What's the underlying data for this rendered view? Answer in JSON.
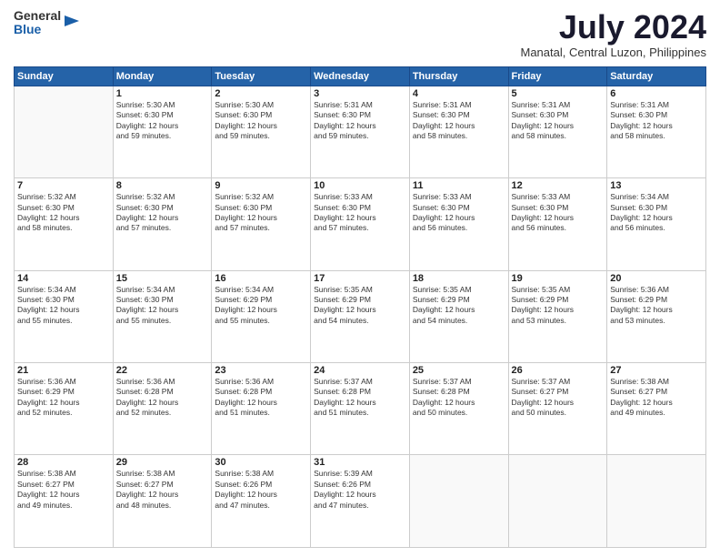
{
  "logo": {
    "general": "General",
    "blue": "Blue"
  },
  "title": "July 2024",
  "location": "Manatal, Central Luzon, Philippines",
  "days_of_week": [
    "Sunday",
    "Monday",
    "Tuesday",
    "Wednesday",
    "Thursday",
    "Friday",
    "Saturday"
  ],
  "weeks": [
    [
      {
        "day": "",
        "info": ""
      },
      {
        "day": "1",
        "info": "Sunrise: 5:30 AM\nSunset: 6:30 PM\nDaylight: 12 hours\nand 59 minutes."
      },
      {
        "day": "2",
        "info": "Sunrise: 5:30 AM\nSunset: 6:30 PM\nDaylight: 12 hours\nand 59 minutes."
      },
      {
        "day": "3",
        "info": "Sunrise: 5:31 AM\nSunset: 6:30 PM\nDaylight: 12 hours\nand 59 minutes."
      },
      {
        "day": "4",
        "info": "Sunrise: 5:31 AM\nSunset: 6:30 PM\nDaylight: 12 hours\nand 58 minutes."
      },
      {
        "day": "5",
        "info": "Sunrise: 5:31 AM\nSunset: 6:30 PM\nDaylight: 12 hours\nand 58 minutes."
      },
      {
        "day": "6",
        "info": "Sunrise: 5:31 AM\nSunset: 6:30 PM\nDaylight: 12 hours\nand 58 minutes."
      }
    ],
    [
      {
        "day": "7",
        "info": "Sunrise: 5:32 AM\nSunset: 6:30 PM\nDaylight: 12 hours\nand 58 minutes."
      },
      {
        "day": "8",
        "info": "Sunrise: 5:32 AM\nSunset: 6:30 PM\nDaylight: 12 hours\nand 57 minutes."
      },
      {
        "day": "9",
        "info": "Sunrise: 5:32 AM\nSunset: 6:30 PM\nDaylight: 12 hours\nand 57 minutes."
      },
      {
        "day": "10",
        "info": "Sunrise: 5:33 AM\nSunset: 6:30 PM\nDaylight: 12 hours\nand 57 minutes."
      },
      {
        "day": "11",
        "info": "Sunrise: 5:33 AM\nSunset: 6:30 PM\nDaylight: 12 hours\nand 56 minutes."
      },
      {
        "day": "12",
        "info": "Sunrise: 5:33 AM\nSunset: 6:30 PM\nDaylight: 12 hours\nand 56 minutes."
      },
      {
        "day": "13",
        "info": "Sunrise: 5:34 AM\nSunset: 6:30 PM\nDaylight: 12 hours\nand 56 minutes."
      }
    ],
    [
      {
        "day": "14",
        "info": "Sunrise: 5:34 AM\nSunset: 6:30 PM\nDaylight: 12 hours\nand 55 minutes."
      },
      {
        "day": "15",
        "info": "Sunrise: 5:34 AM\nSunset: 6:30 PM\nDaylight: 12 hours\nand 55 minutes."
      },
      {
        "day": "16",
        "info": "Sunrise: 5:34 AM\nSunset: 6:29 PM\nDaylight: 12 hours\nand 55 minutes."
      },
      {
        "day": "17",
        "info": "Sunrise: 5:35 AM\nSunset: 6:29 PM\nDaylight: 12 hours\nand 54 minutes."
      },
      {
        "day": "18",
        "info": "Sunrise: 5:35 AM\nSunset: 6:29 PM\nDaylight: 12 hours\nand 54 minutes."
      },
      {
        "day": "19",
        "info": "Sunrise: 5:35 AM\nSunset: 6:29 PM\nDaylight: 12 hours\nand 53 minutes."
      },
      {
        "day": "20",
        "info": "Sunrise: 5:36 AM\nSunset: 6:29 PM\nDaylight: 12 hours\nand 53 minutes."
      }
    ],
    [
      {
        "day": "21",
        "info": "Sunrise: 5:36 AM\nSunset: 6:29 PM\nDaylight: 12 hours\nand 52 minutes."
      },
      {
        "day": "22",
        "info": "Sunrise: 5:36 AM\nSunset: 6:28 PM\nDaylight: 12 hours\nand 52 minutes."
      },
      {
        "day": "23",
        "info": "Sunrise: 5:36 AM\nSunset: 6:28 PM\nDaylight: 12 hours\nand 51 minutes."
      },
      {
        "day": "24",
        "info": "Sunrise: 5:37 AM\nSunset: 6:28 PM\nDaylight: 12 hours\nand 51 minutes."
      },
      {
        "day": "25",
        "info": "Sunrise: 5:37 AM\nSunset: 6:28 PM\nDaylight: 12 hours\nand 50 minutes."
      },
      {
        "day": "26",
        "info": "Sunrise: 5:37 AM\nSunset: 6:27 PM\nDaylight: 12 hours\nand 50 minutes."
      },
      {
        "day": "27",
        "info": "Sunrise: 5:38 AM\nSunset: 6:27 PM\nDaylight: 12 hours\nand 49 minutes."
      }
    ],
    [
      {
        "day": "28",
        "info": "Sunrise: 5:38 AM\nSunset: 6:27 PM\nDaylight: 12 hours\nand 49 minutes."
      },
      {
        "day": "29",
        "info": "Sunrise: 5:38 AM\nSunset: 6:27 PM\nDaylight: 12 hours\nand 48 minutes."
      },
      {
        "day": "30",
        "info": "Sunrise: 5:38 AM\nSunset: 6:26 PM\nDaylight: 12 hours\nand 47 minutes."
      },
      {
        "day": "31",
        "info": "Sunrise: 5:39 AM\nSunset: 6:26 PM\nDaylight: 12 hours\nand 47 minutes."
      },
      {
        "day": "",
        "info": ""
      },
      {
        "day": "",
        "info": ""
      },
      {
        "day": "",
        "info": ""
      }
    ]
  ]
}
